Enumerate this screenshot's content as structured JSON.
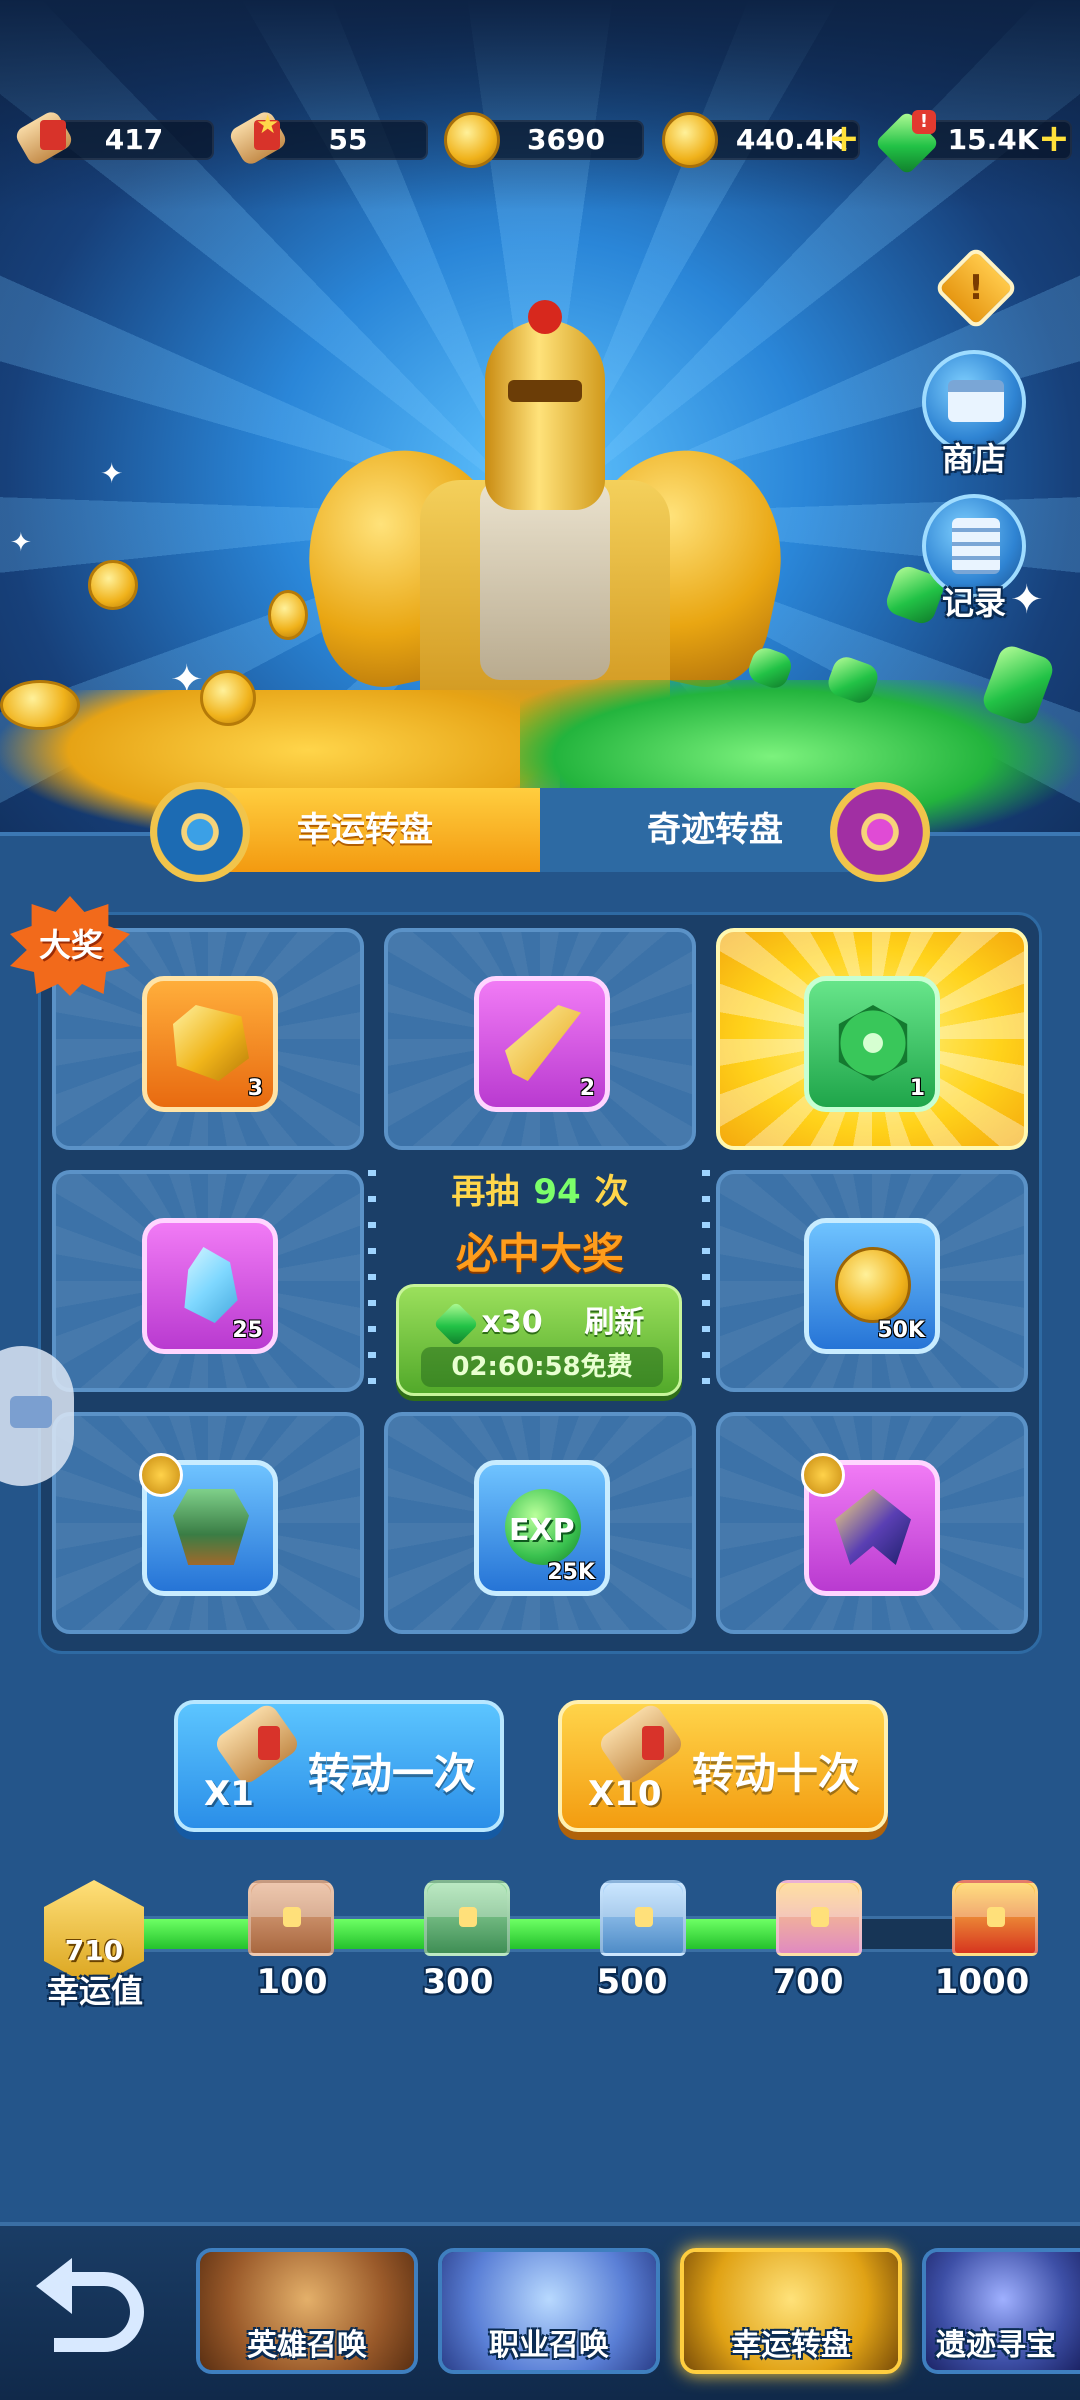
{
  "resources": [
    {
      "icon": "scroll-ticket-icon",
      "value": "417",
      "has_plus": false
    },
    {
      "icon": "star-scroll-icon",
      "value": "55",
      "has_plus": false
    },
    {
      "icon": "bronze-coin-icon",
      "value": "3690",
      "has_plus": false
    },
    {
      "icon": "gold-coin-icon",
      "value": "440.4K",
      "has_plus": true
    },
    {
      "icon": "green-gem-icon",
      "value": "15.4K",
      "has_plus": true
    }
  ],
  "plus_symbol": "+",
  "gem_badge": "!",
  "info_glyph": "!",
  "side_buttons": {
    "shop": "商店",
    "record": "记录"
  },
  "tabs": {
    "lucky_wheel": "幸运转盘",
    "miracle_wheel": "奇迹转盘"
  },
  "grand_prize_badge": "大奖",
  "prizes": [
    {
      "name": "gold-ore",
      "qty": "3",
      "frame": "orange",
      "highlight": false
    },
    {
      "name": "gold-blade",
      "qty": "2",
      "frame": "purple",
      "highlight": false
    },
    {
      "name": "emerald",
      "qty": "1",
      "frame": "green",
      "highlight": true
    },
    {
      "name": "blue-crystal",
      "qty": "25",
      "frame": "purple",
      "highlight": false
    },
    {
      "name": "gold-coin",
      "qty": "50K",
      "frame": "blue",
      "highlight": false
    },
    {
      "name": "green-armor",
      "qty": "",
      "frame": "blue",
      "highlight": false
    },
    {
      "name": "exp-orb",
      "qty": "25K",
      "frame": "blue",
      "highlight": false
    },
    {
      "name": "wizard-cape",
      "qty": "",
      "frame": "purple",
      "highlight": false
    }
  ],
  "exp_label": "EXP",
  "center": {
    "prefix": "再抽",
    "remaining": "94",
    "suffix": "次",
    "guarantee": "必中大奖",
    "refresh_cost": "x30",
    "refresh_label": "刷新",
    "timer": "02:60:58",
    "free_label": "免费"
  },
  "spin_buttons": {
    "once": {
      "label": "转动一次",
      "mult": "X1"
    },
    "ten": {
      "label": "转动十次",
      "mult": "X10"
    }
  },
  "luck": {
    "label": "幸运值",
    "value": "710",
    "progress_fraction": 0.78,
    "milestones": [
      "100",
      "300",
      "500",
      "700",
      "1000"
    ]
  },
  "bottom_nav": [
    {
      "label": "英雄召唤",
      "active": false
    },
    {
      "label": "职业召唤",
      "active": false
    },
    {
      "label": "幸运转盘",
      "active": true
    },
    {
      "label": "遗迹寻宝",
      "active": false
    }
  ],
  "colors": {
    "accent_gold": "#ffce3f",
    "progress_green": "#24c22c",
    "panel_blue": "#24558a"
  }
}
